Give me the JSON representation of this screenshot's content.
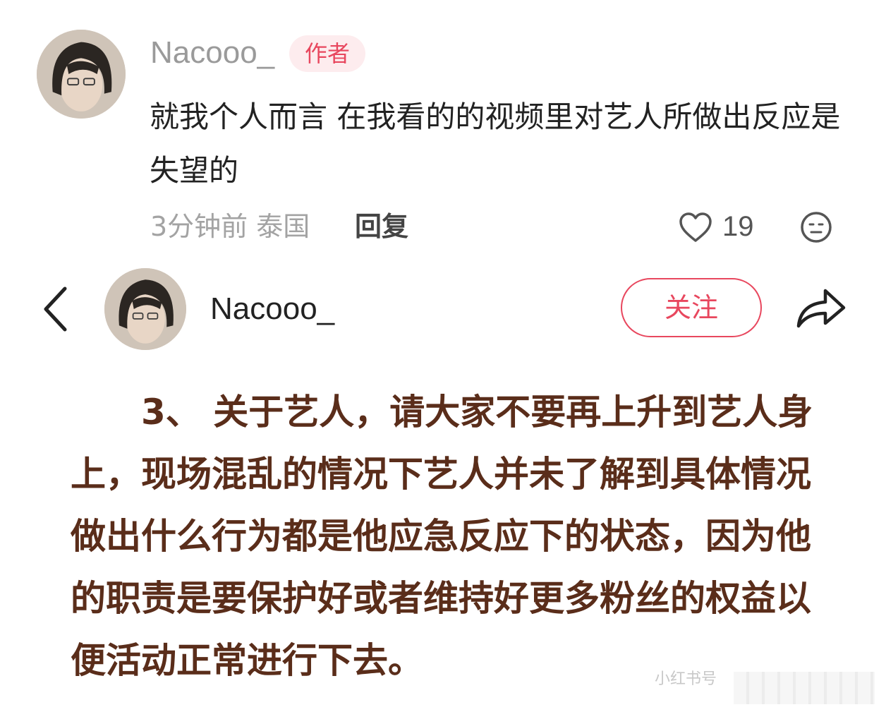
{
  "comment": {
    "username": "Nacooo_",
    "badge": "作者",
    "text": "就我个人而言 在我看的的视频里对艺人所做出反应是失望的",
    "meta": "3分钟前 泰国",
    "reply_label": "回复",
    "like_count": "19",
    "icons": [
      "heart-icon",
      "emoji-icon"
    ]
  },
  "post": {
    "username": "Nacooo_",
    "follow_label": "关注",
    "icons": [
      "back-icon",
      "share-icon"
    ],
    "body": "3、 关于艺人，请大家不要再上升到艺人身上，现场混乱的情况下艺人并未了解到具体情况 做出什么行为都是他应急反应下的状态，因为他的职责是要保护好或者维持好更多粉丝的权益以便活动正常进行下去。"
  },
  "watermark": "小红书号",
  "colors": {
    "accent": "#e8475e",
    "badge_bg": "#fdecee",
    "body_text": "#5a2d1a",
    "muted": "#a3a3a3"
  }
}
